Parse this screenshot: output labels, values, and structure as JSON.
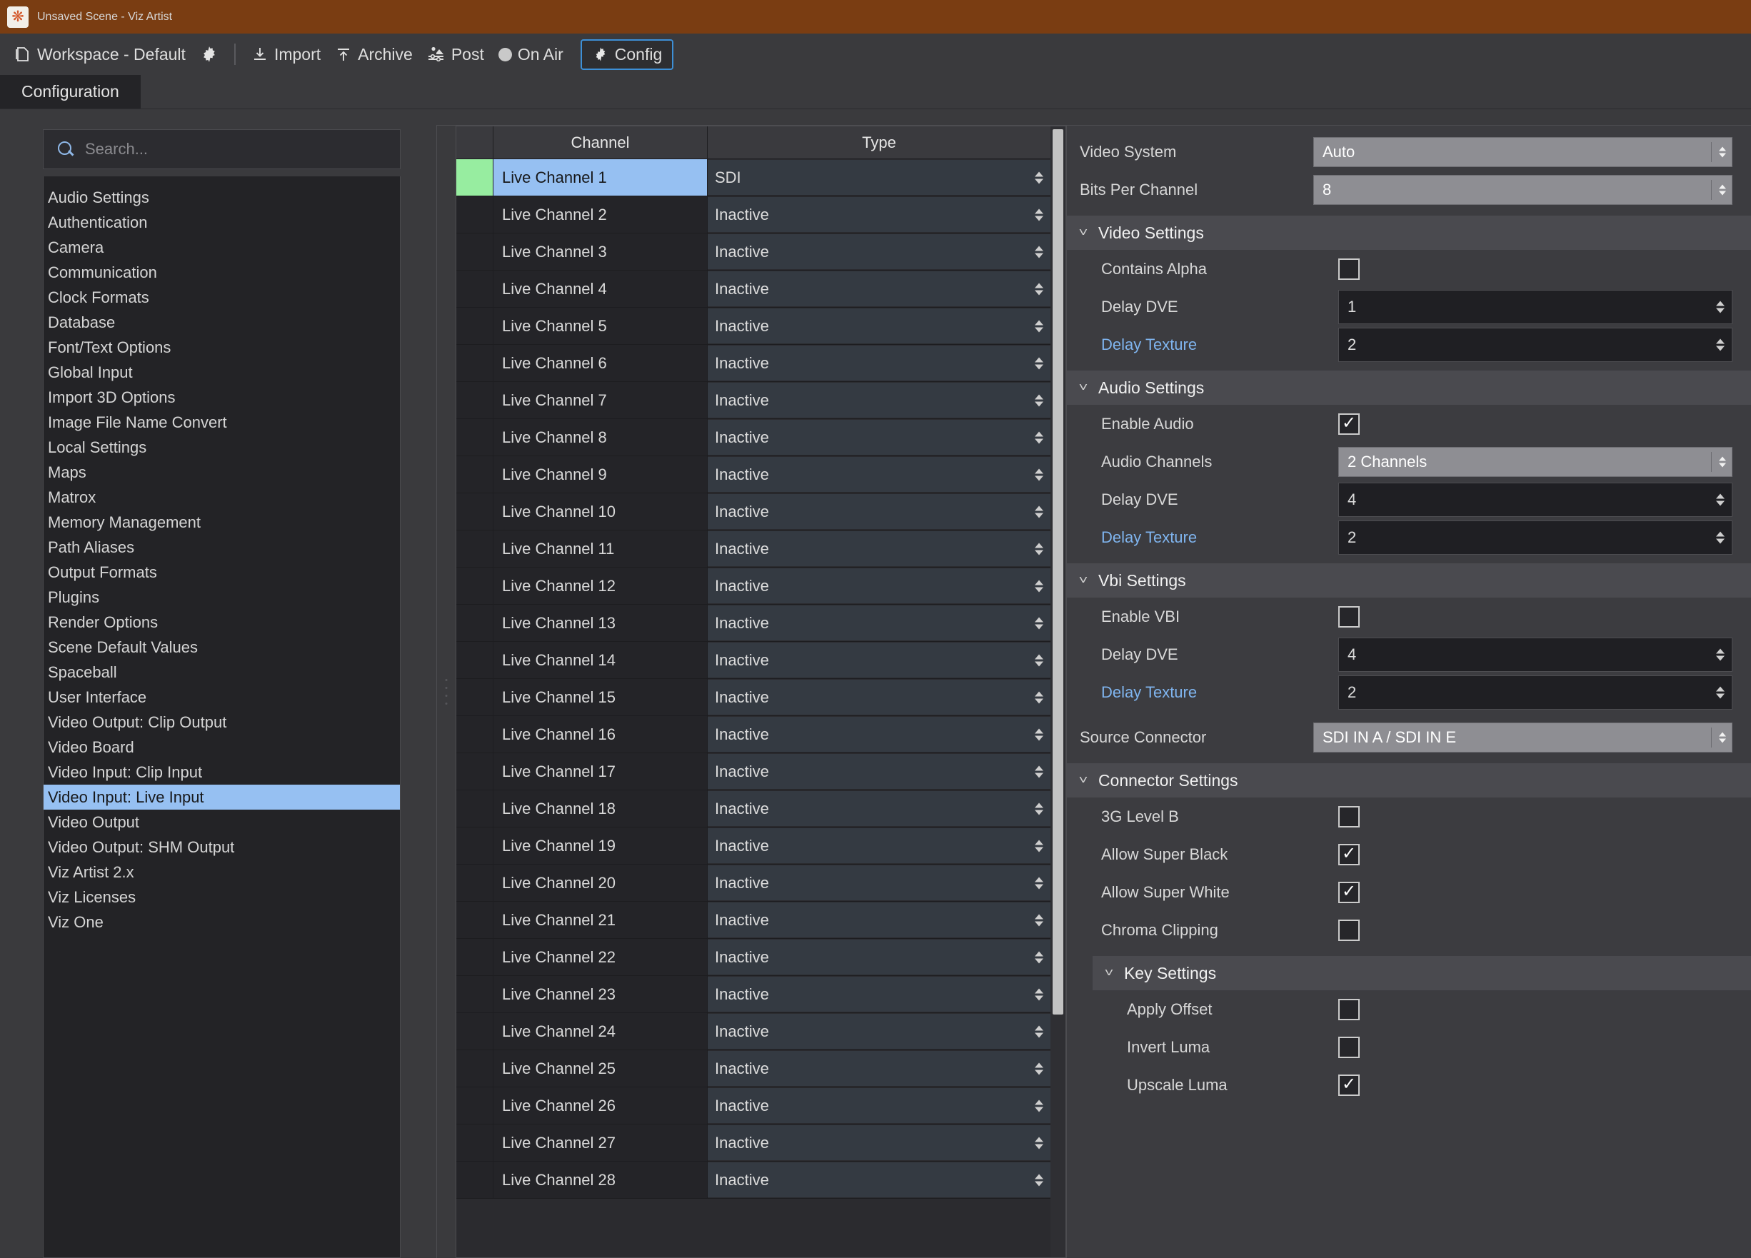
{
  "window": {
    "title": "Unsaved Scene - Viz Artist",
    "app_icon": "viz-asterisk-icon"
  },
  "toolbar": {
    "workspace_label": "Workspace - Default",
    "gear_icon": "gear-icon",
    "import_label": "Import",
    "archive_label": "Archive",
    "post_label": "Post",
    "onair_label": "On Air",
    "config_label": "Config"
  },
  "tabs": [
    {
      "label": "Configuration",
      "active": true
    }
  ],
  "sidebar": {
    "search": {
      "placeholder": "Search...",
      "value": ""
    },
    "items": [
      {
        "label": "Audio Settings",
        "selected": false
      },
      {
        "label": "Authentication",
        "selected": false
      },
      {
        "label": "Camera",
        "selected": false
      },
      {
        "label": "Communication",
        "selected": false
      },
      {
        "label": "Clock Formats",
        "selected": false
      },
      {
        "label": "Database",
        "selected": false
      },
      {
        "label": "Font/Text Options",
        "selected": false
      },
      {
        "label": "Global Input",
        "selected": false
      },
      {
        "label": "Import 3D Options",
        "selected": false
      },
      {
        "label": "Image File Name Convert",
        "selected": false
      },
      {
        "label": "Local Settings",
        "selected": false
      },
      {
        "label": "Maps",
        "selected": false
      },
      {
        "label": "Matrox",
        "selected": false
      },
      {
        "label": "Memory Management",
        "selected": false
      },
      {
        "label": "Path Aliases",
        "selected": false
      },
      {
        "label": "Output Formats",
        "selected": false
      },
      {
        "label": "Plugins",
        "selected": false
      },
      {
        "label": "Render Options",
        "selected": false
      },
      {
        "label": "Scene Default Values",
        "selected": false
      },
      {
        "label": "Spaceball",
        "selected": false
      },
      {
        "label": "User Interface",
        "selected": false
      },
      {
        "label": "Video Output: Clip Output",
        "selected": false
      },
      {
        "label": "Video Board",
        "selected": false
      },
      {
        "label": "Video Input: Clip Input",
        "selected": false
      },
      {
        "label": "Video Input: Live Input",
        "selected": true
      },
      {
        "label": "Video Output",
        "selected": false
      },
      {
        "label": "Video Output: SHM Output",
        "selected": false
      },
      {
        "label": "Viz Artist 2.x",
        "selected": false
      },
      {
        "label": "Viz Licenses",
        "selected": false
      },
      {
        "label": "Viz One",
        "selected": false
      }
    ]
  },
  "table": {
    "columns": [
      "",
      "Channel",
      "Type"
    ],
    "rows": [
      {
        "status": "active",
        "channel": "Live Channel 1",
        "type": "SDI",
        "selected": true
      },
      {
        "status": "",
        "channel": "Live Channel 2",
        "type": "Inactive",
        "selected": false
      },
      {
        "status": "",
        "channel": "Live Channel 3",
        "type": "Inactive",
        "selected": false
      },
      {
        "status": "",
        "channel": "Live Channel 4",
        "type": "Inactive",
        "selected": false
      },
      {
        "status": "",
        "channel": "Live Channel 5",
        "type": "Inactive",
        "selected": false
      },
      {
        "status": "",
        "channel": "Live Channel 6",
        "type": "Inactive",
        "selected": false
      },
      {
        "status": "",
        "channel": "Live Channel 7",
        "type": "Inactive",
        "selected": false
      },
      {
        "status": "",
        "channel": "Live Channel 8",
        "type": "Inactive",
        "selected": false
      },
      {
        "status": "",
        "channel": "Live Channel 9",
        "type": "Inactive",
        "selected": false
      },
      {
        "status": "",
        "channel": "Live Channel 10",
        "type": "Inactive",
        "selected": false
      },
      {
        "status": "",
        "channel": "Live Channel 11",
        "type": "Inactive",
        "selected": false
      },
      {
        "status": "",
        "channel": "Live Channel 12",
        "type": "Inactive",
        "selected": false
      },
      {
        "status": "",
        "channel": "Live Channel 13",
        "type": "Inactive",
        "selected": false
      },
      {
        "status": "",
        "channel": "Live Channel 14",
        "type": "Inactive",
        "selected": false
      },
      {
        "status": "",
        "channel": "Live Channel 15",
        "type": "Inactive",
        "selected": false
      },
      {
        "status": "",
        "channel": "Live Channel 16",
        "type": "Inactive",
        "selected": false
      },
      {
        "status": "",
        "channel": "Live Channel 17",
        "type": "Inactive",
        "selected": false
      },
      {
        "status": "",
        "channel": "Live Channel 18",
        "type": "Inactive",
        "selected": false
      },
      {
        "status": "",
        "channel": "Live Channel 19",
        "type": "Inactive",
        "selected": false
      },
      {
        "status": "",
        "channel": "Live Channel 20",
        "type": "Inactive",
        "selected": false
      },
      {
        "status": "",
        "channel": "Live Channel 21",
        "type": "Inactive",
        "selected": false
      },
      {
        "status": "",
        "channel": "Live Channel 22",
        "type": "Inactive",
        "selected": false
      },
      {
        "status": "",
        "channel": "Live Channel 23",
        "type": "Inactive",
        "selected": false
      },
      {
        "status": "",
        "channel": "Live Channel 24",
        "type": "Inactive",
        "selected": false
      },
      {
        "status": "",
        "channel": "Live Channel 25",
        "type": "Inactive",
        "selected": false
      },
      {
        "status": "",
        "channel": "Live Channel 26",
        "type": "Inactive",
        "selected": false
      },
      {
        "status": "",
        "channel": "Live Channel 27",
        "type": "Inactive",
        "selected": false
      },
      {
        "status": "",
        "channel": "Live Channel 28",
        "type": "Inactive",
        "selected": false
      }
    ]
  },
  "settings": {
    "video_system": {
      "label": "Video System",
      "value": "Auto"
    },
    "bits_per_channel": {
      "label": "Bits Per Channel",
      "value": "8"
    },
    "video_settings": {
      "title": "Video Settings",
      "contains_alpha": {
        "label": "Contains Alpha",
        "checked": false
      },
      "delay_dve": {
        "label": "Delay DVE",
        "value": "1"
      },
      "delay_texture": {
        "label": "Delay Texture",
        "value": "2"
      }
    },
    "audio_settings": {
      "title": "Audio Settings",
      "enable_audio": {
        "label": "Enable Audio",
        "checked": true
      },
      "audio_channels": {
        "label": "Audio Channels",
        "value": "2 Channels"
      },
      "delay_dve": {
        "label": "Delay DVE",
        "value": "4"
      },
      "delay_texture": {
        "label": "Delay Texture",
        "value": "2"
      }
    },
    "vbi_settings": {
      "title": "Vbi Settings",
      "enable_vbi": {
        "label": "Enable VBI",
        "checked": false
      },
      "delay_dve": {
        "label": "Delay DVE",
        "value": "4"
      },
      "delay_texture": {
        "label": "Delay Texture",
        "value": "2"
      }
    },
    "source_connector": {
      "label": "Source Connector",
      "value": "SDI IN A / SDI IN E"
    },
    "connector_settings": {
      "title": "Connector Settings",
      "level_3g_b": {
        "label": "3G Level B",
        "checked": false
      },
      "allow_super_black": {
        "label": "Allow Super Black",
        "checked": true
      },
      "allow_super_white": {
        "label": "Allow Super White",
        "checked": true
      },
      "chroma_clipping": {
        "label": "Chroma Clipping",
        "checked": false
      },
      "key_settings": {
        "title": "Key Settings",
        "apply_offset": {
          "label": "Apply Offset",
          "checked": false
        },
        "invert_luma": {
          "label": "Invert Luma",
          "checked": false
        },
        "upscale_luma": {
          "label": "Upscale Luma",
          "checked": true
        }
      }
    }
  },
  "colors": {
    "titlebar": "#7a3d12",
    "selection": "#96c0f2",
    "active_status": "#97eda0",
    "accent_link": "#7fb4ee",
    "focus_border": "#3d8fd6"
  }
}
